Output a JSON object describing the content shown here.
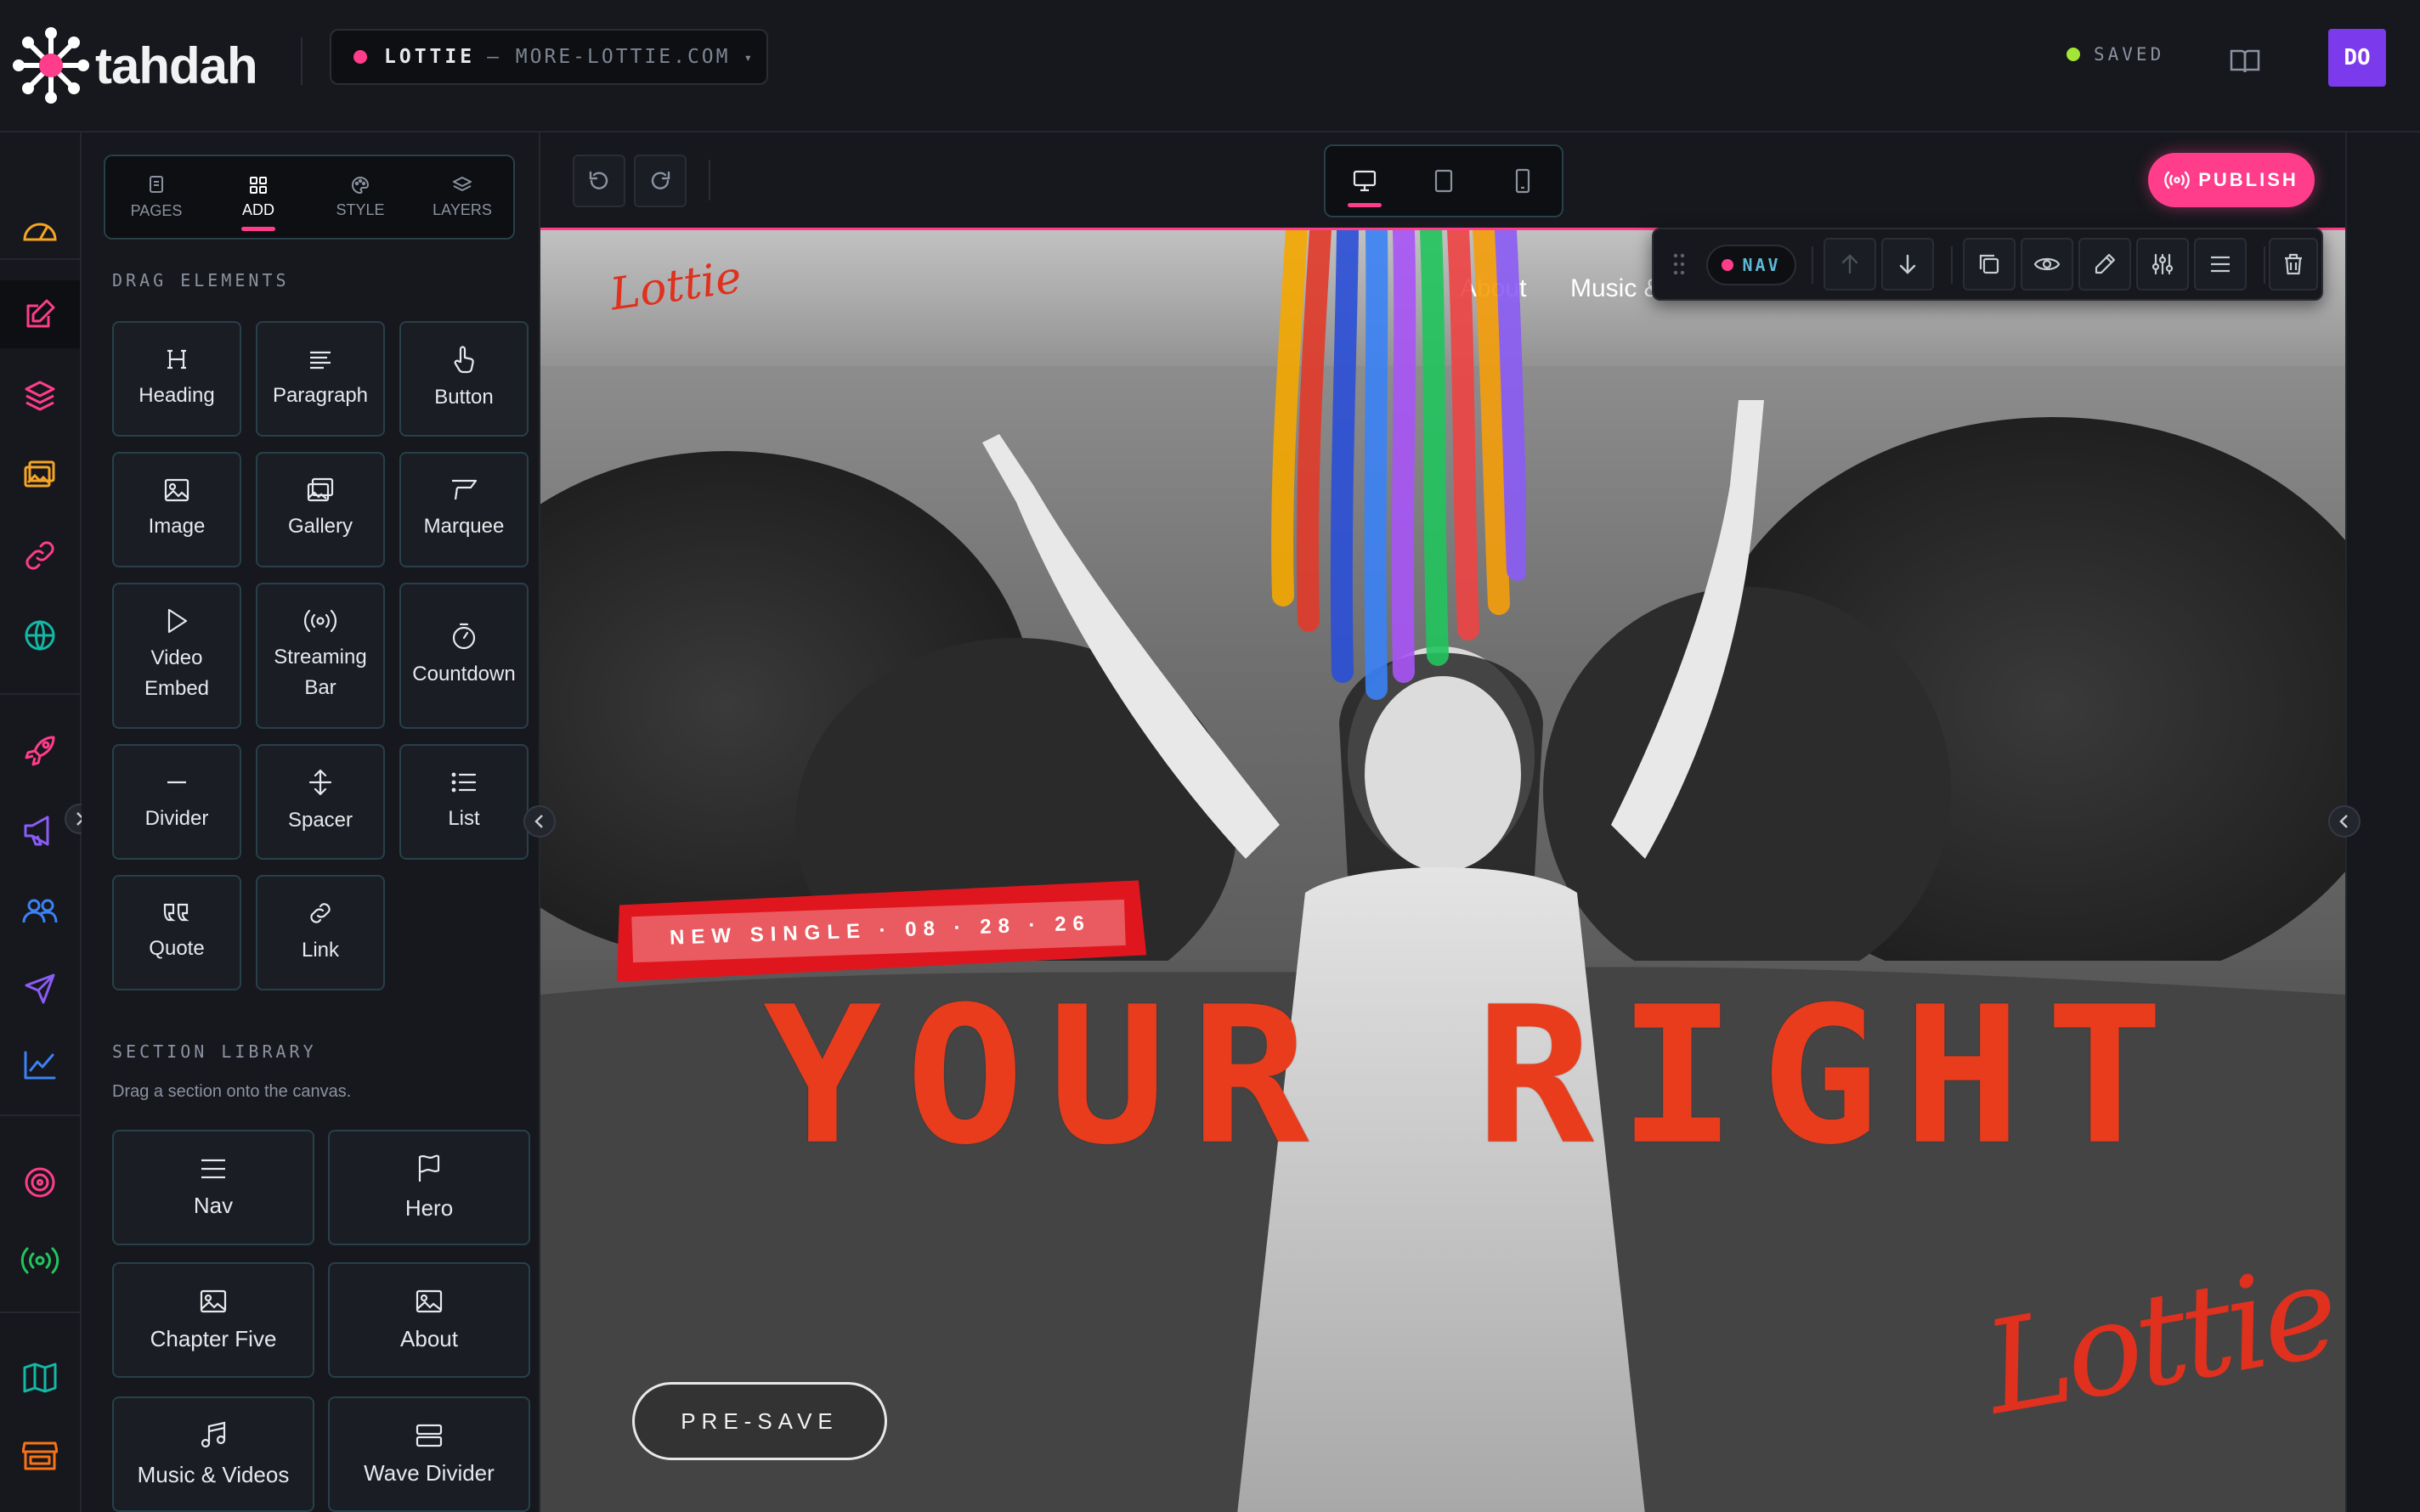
{
  "app": {
    "name": "tahdah"
  },
  "site": {
    "name": "LOTTIE",
    "domain": "— MORE-LOTTIE.COM",
    "caret": "▾"
  },
  "status": {
    "saved": "SAVED"
  },
  "user": {
    "initials": "DO"
  },
  "rail": {
    "icons": [
      "dashboard-icon",
      "edit-icon",
      "layers-icon",
      "gallery-icon",
      "link-icon",
      "globe-icon",
      "rocket-icon",
      "megaphone-icon",
      "audience-icon",
      "send-icon",
      "analytics-icon",
      "vinyl-icon",
      "broadcast-icon",
      "map-icon",
      "store-icon"
    ],
    "colors": {
      "amber": "#f5a524",
      "pink": "#ff3d8b",
      "teal": "#14b8a6",
      "purple": "#8b5cf6",
      "blue": "#3b82f6",
      "green": "#22c55e",
      "orange": "#f97316"
    }
  },
  "panel": {
    "tabs": [
      {
        "label": "PAGES",
        "icon": "pages-icon"
      },
      {
        "label": "ADD",
        "icon": "grid-icon",
        "active": true
      },
      {
        "label": "STYLE",
        "icon": "palette-icon"
      },
      {
        "label": "LAYERS",
        "icon": "layers-icon"
      }
    ],
    "drag_title": "DRAG ELEMENTS",
    "elements": [
      {
        "label": "Heading",
        "icon": "heading-icon"
      },
      {
        "label": "Paragraph",
        "icon": "paragraph-icon"
      },
      {
        "label": "Button",
        "icon": "pointer-icon"
      },
      {
        "label": "Image",
        "icon": "image-icon"
      },
      {
        "label": "Gallery",
        "icon": "gallery-icon"
      },
      {
        "label": "Marquee",
        "icon": "marquee-icon"
      },
      {
        "label": "Video\nEmbed",
        "icon": "play-icon"
      },
      {
        "label": "Streaming\nBar",
        "icon": "broadcast-icon"
      },
      {
        "label": "Countdown",
        "icon": "stopwatch-icon"
      },
      {
        "label": "Divider",
        "icon": "divider-icon"
      },
      {
        "label": "Spacer",
        "icon": "spacer-icon"
      },
      {
        "label": "List",
        "icon": "list-icon"
      },
      {
        "label": "Quote",
        "icon": "quote-icon"
      },
      {
        "label": "Link",
        "icon": "link-icon"
      }
    ],
    "section_title": "SECTION LIBRARY",
    "section_sub": "Drag a section onto the canvas.",
    "sections": [
      {
        "label": "Nav",
        "icon": "menu-icon"
      },
      {
        "label": "Hero",
        "icon": "flag-icon"
      },
      {
        "label": "Chapter Five",
        "icon": "image-icon"
      },
      {
        "label": "About",
        "icon": "image-icon"
      },
      {
        "label": "Music & Videos",
        "icon": "music-icon"
      },
      {
        "label": "Wave Divider",
        "icon": "rows-icon"
      }
    ]
  },
  "toolbar": {
    "publish": "PUBLISH",
    "devices": [
      "desktop-icon",
      "tablet-icon",
      "mobile-icon"
    ]
  },
  "element_toolbar": {
    "chip": "NAV"
  },
  "canvas": {
    "site_logo": "Lottie",
    "nav_links": [
      "About",
      "Music &"
    ],
    "single_tag": "NEW SINGLE · 08 · 28 · 26",
    "headline": "YOUR RIGHT",
    "cta": "PRE-SAVE",
    "logo_big": "Lottie"
  }
}
